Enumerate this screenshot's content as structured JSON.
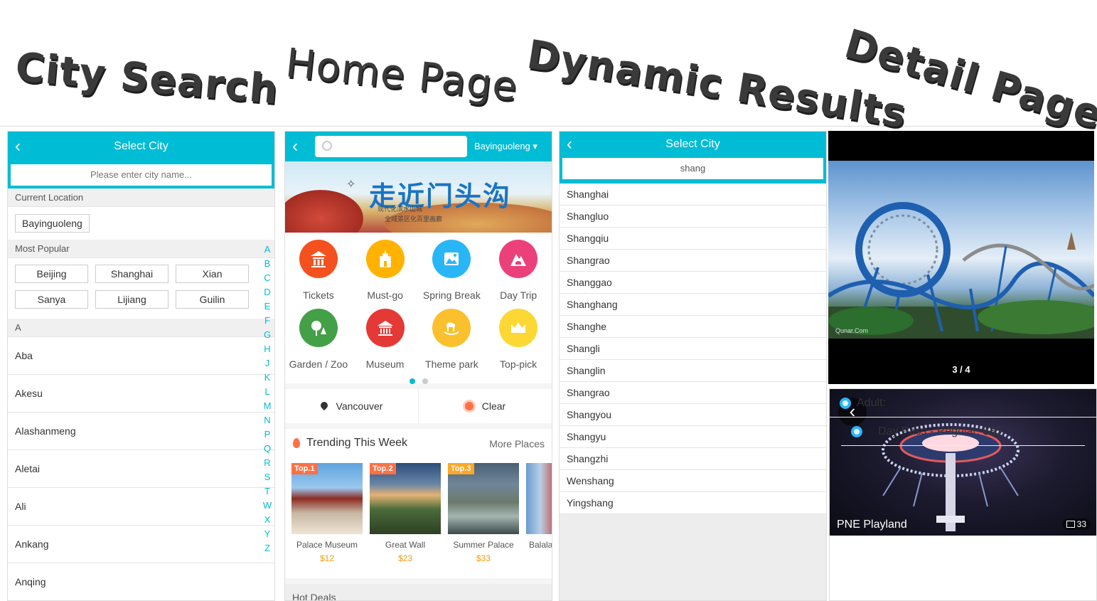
{
  "titles": [
    "City Search",
    "Home Page",
    "Dynamic Results",
    "Detail Page"
  ],
  "city_search": {
    "header_title": "Select City",
    "search_placeholder": "Please enter city name...",
    "current_location_label": "Current Location",
    "current_location": "Bayinguoleng",
    "most_popular_label": "Most Popular",
    "popular": [
      "Beijing",
      "Shanghai",
      "Xian",
      "Sanya",
      "Lijiang",
      "Guilin"
    ],
    "section_letter": "A",
    "cities": [
      "Aba",
      "Akesu",
      "Alashanmeng",
      "Aletai",
      "Ali",
      "Ankang",
      "Anqing"
    ],
    "alphabet": [
      "A",
      "B",
      "C",
      "D",
      "E",
      "F",
      "G",
      "H",
      "J",
      "K",
      "L",
      "M",
      "N",
      "P",
      "Q",
      "R",
      "S",
      "T",
      "W",
      "X",
      "Y",
      "Z"
    ]
  },
  "home": {
    "city": "Bayinguoleng",
    "banner": {
      "title": "走近门头沟",
      "line1": "现代化滨水山城",
      "line2": "全域景区化百里画廊"
    },
    "categories": [
      {
        "label": "Tickets",
        "color": "#f4511e",
        "icon": "temple-icon"
      },
      {
        "label": "Must-go",
        "color": "#ffb300",
        "icon": "landmark-icon"
      },
      {
        "label": "Spring Break",
        "color": "#29b6f6",
        "icon": "map-icon"
      },
      {
        "label": "Day Trip",
        "color": "#ec407a",
        "icon": "mountain-icon"
      },
      {
        "label": "Garden / Zoo",
        "color": "#43a047",
        "icon": "tree-icon"
      },
      {
        "label": "Museum",
        "color": "#e53935",
        "icon": "museum-icon"
      },
      {
        "label": "Theme park",
        "color": "#fbc02d",
        "icon": "rocking-horse-icon"
      },
      {
        "label": "Top-pick",
        "color": "#fdd835",
        "icon": "crown-icon"
      }
    ],
    "weather": {
      "location": "Vancouver",
      "condition": "Clear"
    },
    "trending_title": "Trending This Week",
    "more_places": "More Places",
    "trending": [
      {
        "tag": "Top.1",
        "name": "Palace Museum",
        "price": "$12"
      },
      {
        "tag": "Top.2",
        "name": "Great Wall",
        "price": "$23"
      },
      {
        "tag": "Top.3",
        "name": "Summer Palace",
        "price": "$33"
      },
      {
        "tag": "",
        "name": "Balala",
        "price": ""
      }
    ],
    "hot_deals": "Hot Deals"
  },
  "results": {
    "header_title": "Select City",
    "query": "shang",
    "items": [
      "Shanghai",
      "Shangluo",
      "Shangqiu",
      "Shangrao",
      "Shanggao",
      "Shanghang",
      "Shanghe",
      "Shangli",
      "Shanglin",
      "Shangrao",
      "Shangyou",
      "Shangyu",
      "Shangzhi",
      "Wenshang",
      "Yingshang"
    ]
  },
  "detail": {
    "counter": "3 / 4",
    "watermark": "Qunar.Com",
    "park_name": "PNE Playland",
    "photo_count": "33",
    "adult_label": "Adult:",
    "price_line": "Day Pass - Regular: $35"
  }
}
